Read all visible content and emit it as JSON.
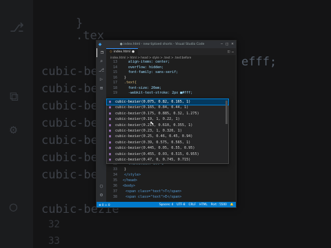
{
  "background": {
    "code_lines": [
      {
        "text": "}",
        "color": "#6b7380"
      },
      {
        "text": ".tex",
        "color": "#6b7380"
      },
      {
        "text": "cubic-bezie",
        "color": "#7f95b8"
      },
      {
        "text": "cubic-bezie",
        "color": "#7f95b8"
      },
      {
        "text": "cubic-bezie",
        "color": "#7f95b8"
      },
      {
        "text": "cubic-bezie",
        "color": "#7f95b8"
      },
      {
        "text": "cubic-bezie",
        "color": "#7f95b8"
      },
      {
        "text": "cubic-bezie",
        "color": "#7f95b8"
      },
      {
        "text": "cubic-bezie",
        "color": "#7f95b8"
      },
      {
        "text": "cubic-bezie",
        "color": "#7f95b8"
      }
    ],
    "right_text": "efff;",
    "line_numbers": [
      "32",
      "33"
    ]
  },
  "window": {
    "title": "● index.html - new tiptoed shorts - Visual Studio Code",
    "tab_label": "index.html",
    "breadcrumb": "index.html > html > head > style > .text > .text:before",
    "code_lines": [
      {
        "num": "13",
        "text": "align-items: center;",
        "cls": "c-prop"
      },
      {
        "num": "14",
        "text": "overflow: hidden;",
        "cls": "c-prop"
      },
      {
        "num": "15",
        "text": "font-family: sans-serif;",
        "cls": "c-prop"
      },
      {
        "num": "16",
        "text": "}",
        "cls": "c-punc"
      },
      {
        "num": "17",
        "text": ".text{",
        "cls": "c-sel"
      },
      {
        "num": "18",
        "text": "font-size: 20em;",
        "cls": "c-prop"
      },
      {
        "num": "19",
        "text": "-webkit-text-stroke: 2px ■#fff;",
        "cls": "c-prop"
      },
      {
        "num": "32",
        "text": "transition: all 1",
        "cls": "c-prop"
      },
      {
        "num": "33",
        "text": "}",
        "cls": "c-punc"
      },
      {
        "num": "34",
        "text": "</style>",
        "cls": "c-tag"
      },
      {
        "num": "35",
        "text": "</head>",
        "cls": "c-tag"
      },
      {
        "num": "36",
        "text": "<body>",
        "cls": "c-tag"
      },
      {
        "num": "37",
        "text": "<span class=\"text\">T</span>",
        "cls": "c-tag"
      },
      {
        "num": "38",
        "text": "<span class=\"text\">E</span>",
        "cls": "c-tag"
      }
    ],
    "suggestions": [
      "cubic-bezier(0.075, 0.82, 0.165, 1)",
      "cubic-bezier(0.165, 0.84, 0.44, 1)",
      "cubic-bezier(0.175, 0.885, 0.32, 1.275)",
      "cubic-bezier(0.19, 1, 0.22, 1)",
      "cubic-bezier(0.215, 0.610, 0.355, 1)",
      "cubic-bezier(0.23, 1, 0.320, 1)",
      "cubic-bezier(0.25, 0.46, 0.45, 0.94)",
      "cubic-bezier(0.39, 0.575, 0.565, 1)",
      "cubic-bezier(0.445, 0.05, 0.55, 0.95)",
      "cubic-bezier(0.455, 0.03, 0.515, 0.955)",
      "cubic-bezier(0.47, 0, 0.745, 0.715)",
      "cubic-bezier(0.55, 0.055, 0.675, 0.19)"
    ],
    "status": {
      "left": "⊗ 0 ⚠ 0",
      "spaces": "Spaces: 4",
      "encoding": "UTF-8",
      "eol": "CRLF",
      "lang": "HTML",
      "port": "Port : 5500"
    }
  }
}
